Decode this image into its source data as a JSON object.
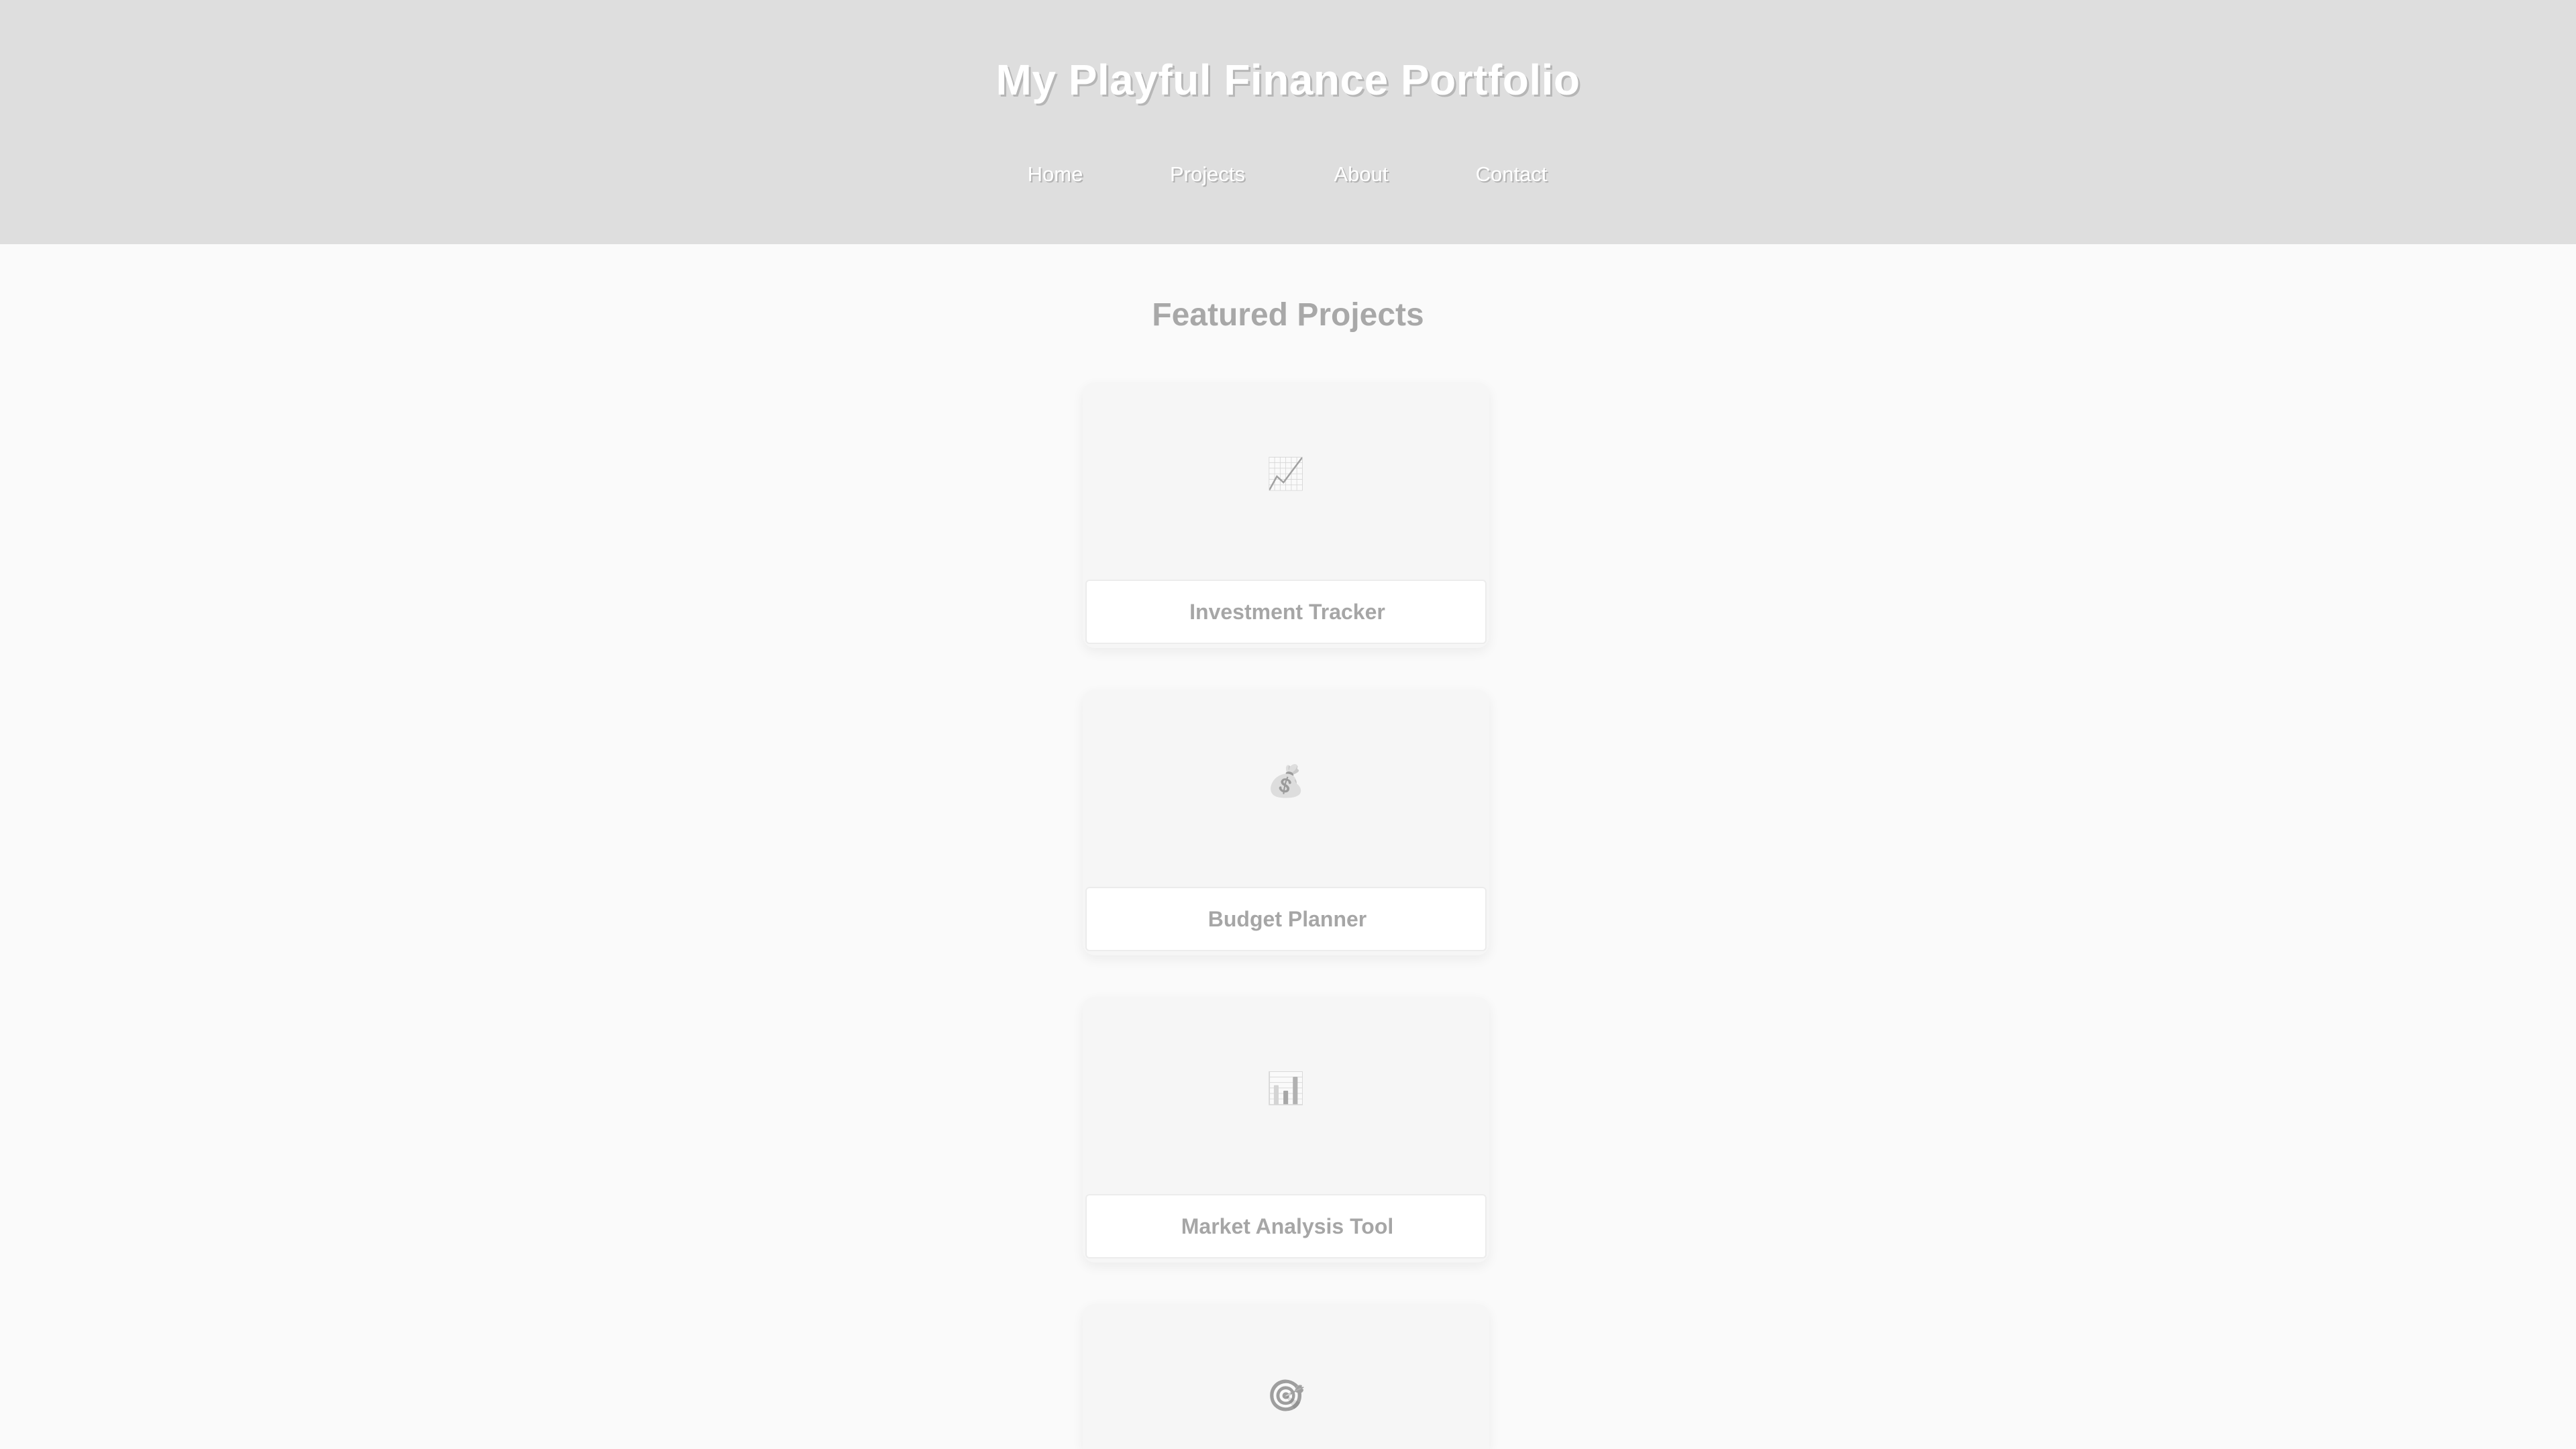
{
  "header": {
    "title": "My Playful Finance Portfolio",
    "nav": [
      {
        "label": "Home"
      },
      {
        "label": "Projects"
      },
      {
        "label": "About"
      },
      {
        "label": "Contact"
      }
    ]
  },
  "main": {
    "section_title": "Featured Projects",
    "projects": [
      {
        "title": "Investment Tracker",
        "icon": "chart-increasing-icon",
        "icon_glyph": "📈"
      },
      {
        "title": "Budget Planner",
        "icon": "money-bag-icon",
        "icon_glyph": "💰"
      },
      {
        "title": "Market Analysis Tool",
        "icon": "bar-chart-icon",
        "icon_glyph": "📊"
      },
      {
        "title": "",
        "icon": "target-icon",
        "icon_glyph": "🎯"
      }
    ]
  },
  "colors": {
    "header_bg": "#dedede",
    "page_bg": "#fafafa",
    "text_muted": "#a6a6a6"
  }
}
